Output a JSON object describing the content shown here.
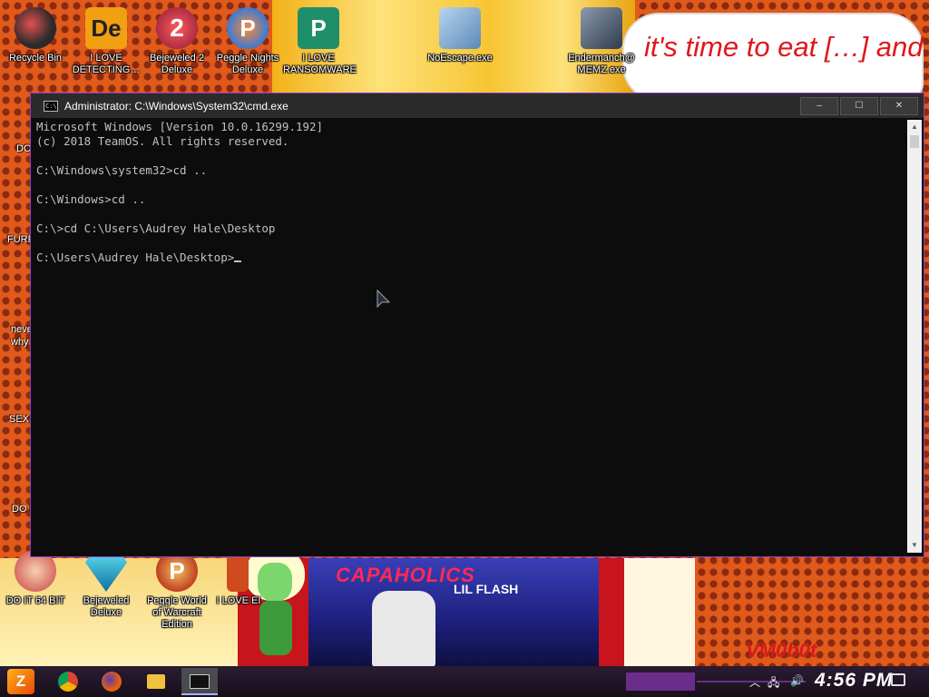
{
  "desktop": {
    "top_icons": [
      {
        "label": "Recycle Bin",
        "icon": "recycle-bin-icon",
        "color": "#2a2a2a"
      },
      {
        "label": "I LOVE DETECTING…",
        "icon": "detective-app-icon",
        "color": "#f0a010"
      },
      {
        "label": "Bejeweled 2 Deluxe",
        "icon": "bejeweled-icon",
        "color": "#c03030"
      },
      {
        "label": "Peggle Nights Deluxe",
        "icon": "peggle-icon",
        "color": "#3a7ad8"
      },
      {
        "label": "I LOVE RANSOMWARE",
        "icon": "publisher-icon",
        "color": "#1f8f6a"
      },
      {
        "label": "NoEscape.exe",
        "icon": "noescape-icon",
        "color": "#5a8ab8"
      },
      {
        "label": "Endermanch@ MEMZ.exe",
        "icon": "memz-icon",
        "color": "#404a5a"
      }
    ],
    "side_labels": [
      "DO",
      "FURF",
      "neve",
      "why",
      "SEX",
      "DO I"
    ],
    "bottom_icons": [
      {
        "label": "DO IT 64 BIT",
        "icon": "app-icon",
        "color": "#c84040"
      },
      {
        "label": "Bejeweled Deluxe",
        "icon": "bejeweled-deluxe-icon",
        "color": "#20a0c0"
      },
      {
        "label": "Peggle World of Warcraft Edition",
        "icon": "peggle-wow-icon",
        "color": "#c04020"
      },
      {
        "label": "I LOVE EI",
        "icon": "app-icon",
        "color": "#d04a20"
      }
    ],
    "speech_text": "it's time to eat […] and die and chew",
    "album_title": "CAPAHOLICS",
    "album_artist": "LIL FLASH",
    "wallpaper_brand": "VM0b0t"
  },
  "cmd": {
    "title": "Administrator: C:\\Windows\\System32\\cmd.exe",
    "controls": {
      "minimize": "–",
      "maximize": "☐",
      "close": "✕"
    },
    "lines": [
      "Microsoft Windows [Version 10.0.16299.192]",
      "(c) 2018 TeamOS. All rights reserved.",
      "",
      "C:\\Windows\\system32>cd ..",
      "",
      "C:\\Windows>cd ..",
      "",
      "C:\\>cd C:\\Users\\Audrey Hale\\Desktop",
      "",
      "C:\\Users\\Audrey Hale\\Desktop>"
    ]
  },
  "taskbar": {
    "start_label": "Z",
    "apps": [
      {
        "name": "chrome",
        "color": "#e8b020"
      },
      {
        "name": "firefox",
        "color": "#e86010"
      },
      {
        "name": "file-explorer",
        "color": "#f0c040"
      },
      {
        "name": "cmd",
        "color": "#202020"
      }
    ],
    "clock": "4:56 PM"
  }
}
